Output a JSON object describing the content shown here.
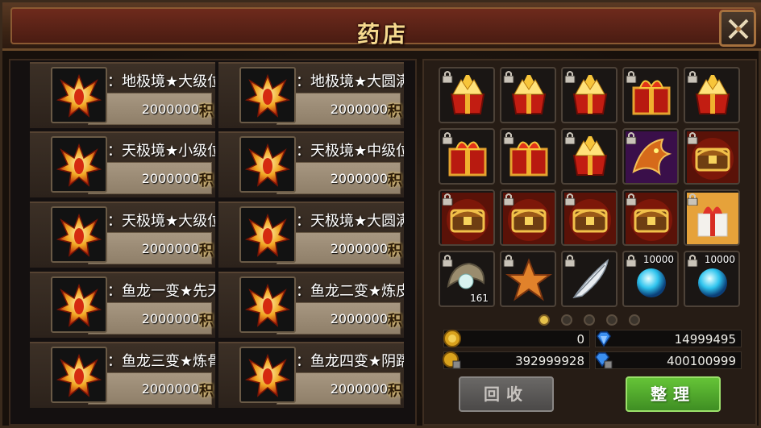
{
  "title": "药店",
  "price_unit": "积",
  "shop": [
    {
      "name": "称号：地极境★大级位",
      "price": "2000000"
    },
    {
      "name": "称号：地极境★大圆满",
      "price": "2000000"
    },
    {
      "name": "称号：天极境★小级位",
      "price": "2000000"
    },
    {
      "name": "称号：天极境★中级位",
      "price": "2000000"
    },
    {
      "name": "称号：天极境★大级位",
      "price": "2000000"
    },
    {
      "name": "称号：天极境★大圆满",
      "price": "2000000"
    },
    {
      "name": "称号：鱼龙一变★先天胎息",
      "price": "2000000"
    },
    {
      "name": "称号：鱼龙二变★炼皮成",
      "price": "2000000"
    },
    {
      "name": "称号：鱼龙三变★炼骨化",
      "price": "2000000"
    },
    {
      "name": "称号：鱼龙四变★阴蹻会",
      "price": "2000000"
    }
  ],
  "bag": [
    {
      "icon": "gift-box-gold-icon",
      "count": "",
      "top": ""
    },
    {
      "icon": "gift-box-gold-icon",
      "count": "",
      "top": ""
    },
    {
      "icon": "gift-box-gold-icon",
      "count": "",
      "top": ""
    },
    {
      "icon": "gift-box-red-icon",
      "count": "",
      "top": ""
    },
    {
      "icon": "gift-box-gold-icon",
      "count": "",
      "top": ""
    },
    {
      "icon": "gift-box-red-icon",
      "count": "",
      "top": ""
    },
    {
      "icon": "gift-box-red-icon",
      "count": "",
      "top": ""
    },
    {
      "icon": "gift-box-gold-icon",
      "count": "",
      "top": ""
    },
    {
      "icon": "dragon-head-icon",
      "count": "",
      "top": ""
    },
    {
      "icon": "treasure-chest-icon",
      "count": "",
      "top": ""
    },
    {
      "icon": "treasure-chest-icon",
      "count": "",
      "top": ""
    },
    {
      "icon": "treasure-chest-icon",
      "count": "",
      "top": ""
    },
    {
      "icon": "treasure-chest-icon",
      "count": "",
      "top": ""
    },
    {
      "icon": "treasure-chest-icon",
      "count": "",
      "top": ""
    },
    {
      "icon": "present-box-icon",
      "count": "",
      "top": ""
    },
    {
      "icon": "pearl-shell-icon",
      "count": "161",
      "top": ""
    },
    {
      "icon": "star-icon",
      "count": "",
      "top": ""
    },
    {
      "icon": "feather-icon",
      "count": "",
      "top": ""
    },
    {
      "icon": "blue-orb-icon",
      "count": "",
      "top": "10000"
    },
    {
      "icon": "blue-orb-icon",
      "count": "",
      "top": "10000"
    }
  ],
  "currencies": {
    "gold": "0",
    "diamond": "14999495",
    "bound_gold": "392999928",
    "bound_diamond": "400100999"
  },
  "buttons": {
    "recycle": "回收",
    "sort": "整理"
  },
  "colors": {
    "accent_gold": "#f6d98e",
    "sort_green": "#4fae2c",
    "panel_brown": "#261c15"
  }
}
